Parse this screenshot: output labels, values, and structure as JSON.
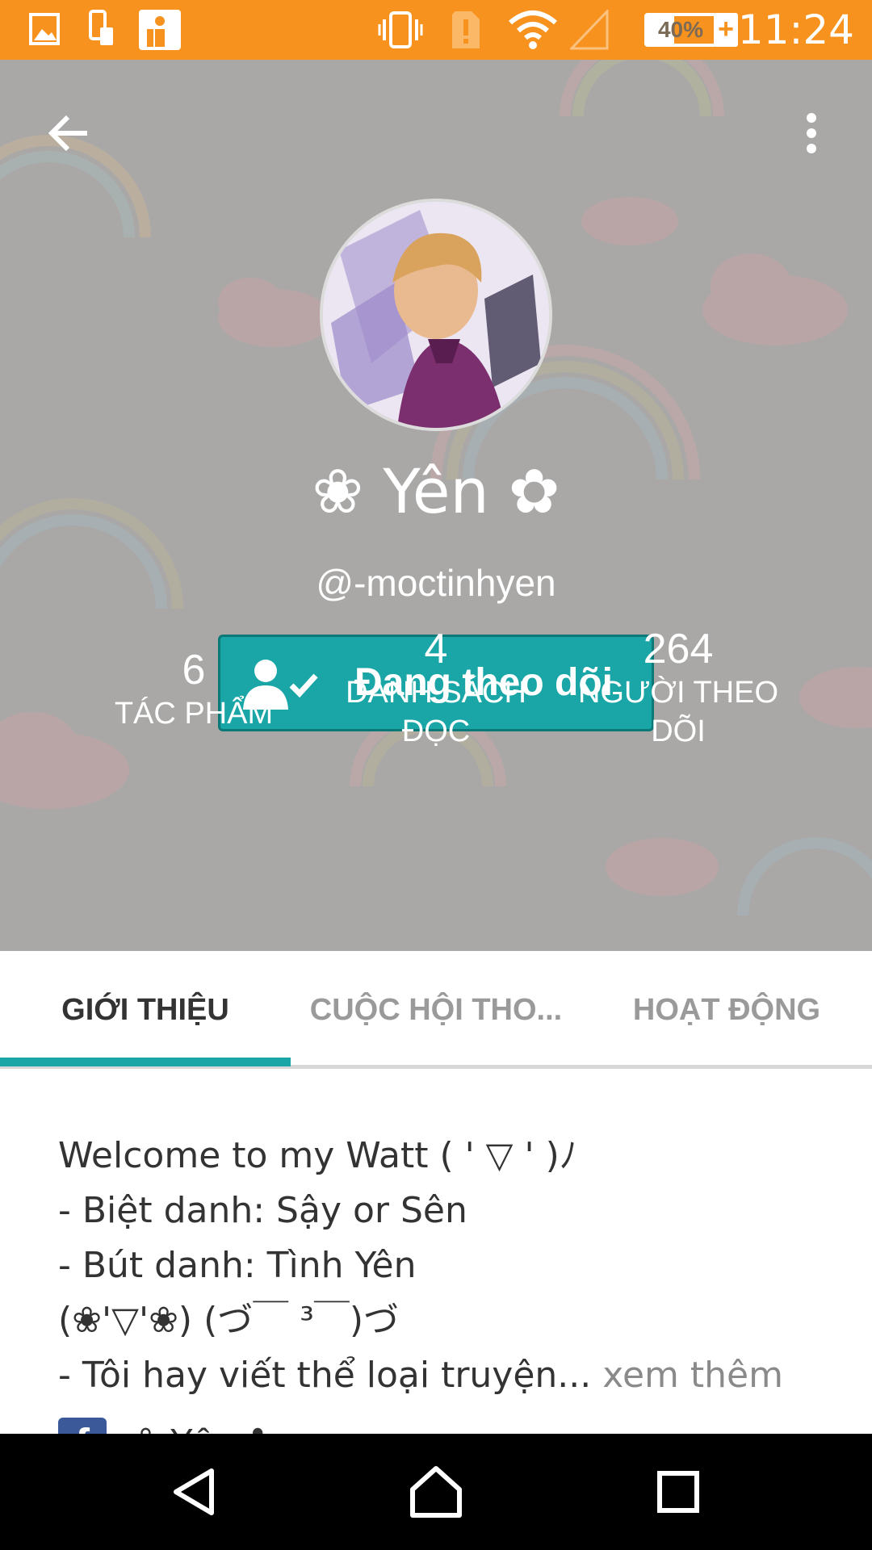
{
  "status_bar": {
    "time": "11:24",
    "battery": "40%",
    "battery_level": 0.4,
    "icons": [
      "image-icon",
      "phone-icon",
      "app-icon",
      "vibrate-icon",
      "alert-icon",
      "wifi-icon",
      "signal-icon",
      "battery-icon",
      "charging-icon"
    ]
  },
  "header": {
    "back_icon": "arrow-left-icon",
    "more_icon": "more-vertical-icon",
    "display_name": "❀ Yên ✿",
    "username": "@-moctinhyen",
    "follow_button": {
      "label": "Đang theo dõi",
      "icon": "user-check-icon"
    },
    "stats": [
      {
        "value": "6",
        "label": "TÁC PHẨM"
      },
      {
        "value": "4",
        "label": "DANH SÁCH ĐỌC"
      },
      {
        "value": "264",
        "label": "NGƯỜI THEO DÕI"
      }
    ]
  },
  "tabs": [
    {
      "label": "GIỚI THIỆU",
      "active": true
    },
    {
      "label": "CUỘC HỘI THO...",
      "active": false
    },
    {
      "label": "HOẠT ĐỘNG",
      "active": false
    }
  ],
  "about": {
    "lines": [
      "Welcome to my Watt ( ' ▽ ' )ﾉ",
      "- Biệt danh: Sậy or Sên",
      "- Bút danh: Tình Yên",
      "(❀'▽'❀) (づ￣ ³￣)づ",
      "- Tôi hay viết thể loại truyện..."
    ],
    "more_link": "xem thêm",
    "facebook": {
      "icon": "facebook-icon",
      "text": "❀ Yên ✿"
    }
  },
  "colors": {
    "status_bar": "#f7921e",
    "accent": "#1aa6a6",
    "header_bg": "#a9a8a7",
    "nav_bar": "#000000"
  },
  "nav_bar": {
    "icons": [
      "back-triangle-icon",
      "home-icon",
      "recents-icon"
    ]
  }
}
